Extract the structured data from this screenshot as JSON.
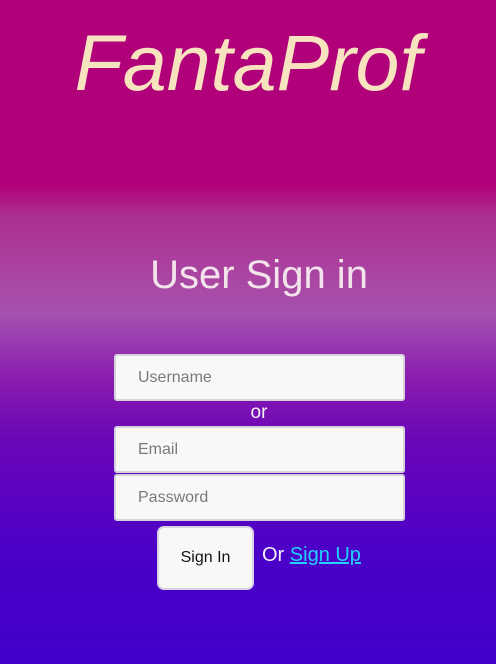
{
  "brand": {
    "title": "FantaProf"
  },
  "page": {
    "heading": "User Sign in"
  },
  "form": {
    "username": {
      "placeholder": "Username",
      "value": ""
    },
    "separator": "or",
    "email": {
      "placeholder": "Email",
      "value": ""
    },
    "password": {
      "placeholder": "Password",
      "value": ""
    },
    "submit_label": "Sign In",
    "alt_prefix": "Or",
    "signup_label": "Sign Up"
  },
  "colors": {
    "background_top": "#b0007a",
    "background_bottom": "#4200cc",
    "brand_text": "#f8e3bf",
    "link": "#20d4ff"
  }
}
